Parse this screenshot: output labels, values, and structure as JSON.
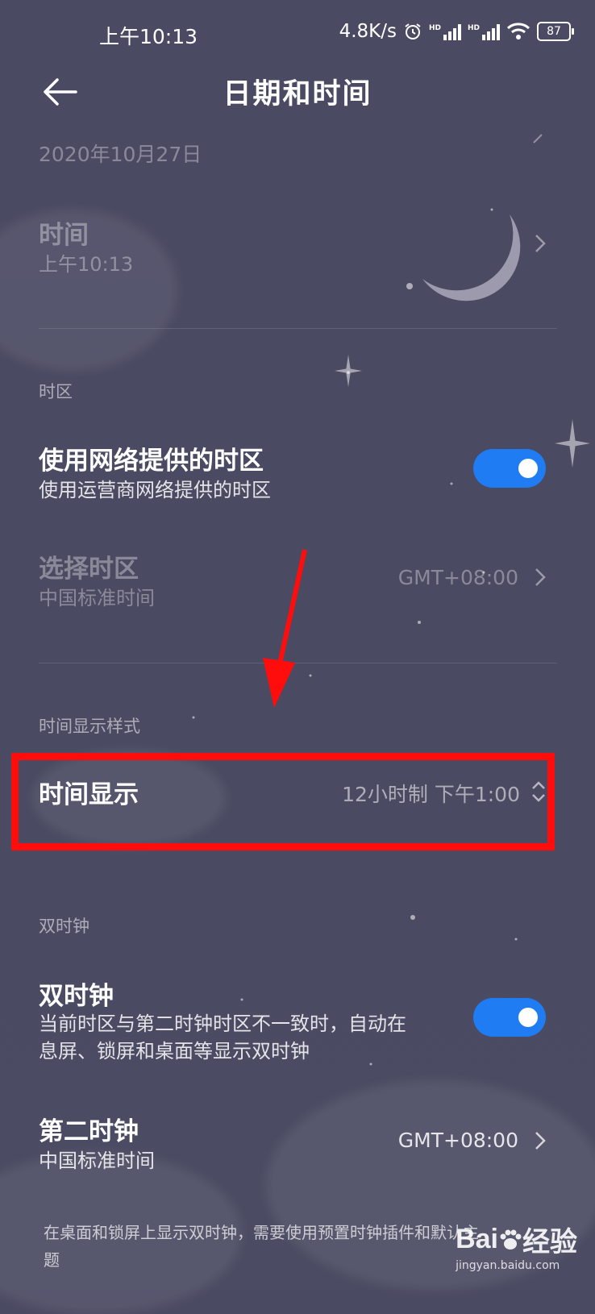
{
  "status_bar": {
    "time": "上午10:13",
    "net_speed": "4.8K/s",
    "battery": "87",
    "icons": [
      "alarm-icon",
      "hd-signal-icon",
      "hd-signal-icon",
      "wifi-icon",
      "battery-icon"
    ]
  },
  "header": {
    "title": "日期和时间",
    "back_icon": "back-arrow-icon"
  },
  "rows": {
    "date_value": "2020年10月27日",
    "time_label": "时间",
    "time_value": "上午10:13"
  },
  "timezone": {
    "section": "时区",
    "network_tz_label": "使用网络提供的时区",
    "network_tz_sub": "使用运营商网络提供的时区",
    "network_tz_on": true,
    "select_tz_label": "选择时区",
    "select_tz_sub": "中国标准时间",
    "select_tz_value": "GMT+08:00"
  },
  "display_style": {
    "section": "时间显示样式",
    "label": "时间显示",
    "value": "12小时制 下午1:00"
  },
  "dual_clock": {
    "section": "双时钟",
    "label": "双时钟",
    "sub_line1": "当前时区与第二时钟时区不一致时，自动在",
    "sub_line2": "息屏、锁屏和桌面等显示双时钟",
    "on": true,
    "second_label": "第二时钟",
    "second_sub": "中国标准时间",
    "second_value": "GMT+08:00"
  },
  "footer": {
    "line1": "在桌面和锁屏上显示双时钟，需要使用预置时钟插件和默认主",
    "line2": "题"
  },
  "watermark": {
    "brand": "Bai",
    "brand2": "经验",
    "site": "jingyan.baidu.com"
  },
  "colors": {
    "background": "#4b4a63",
    "toggle_on": "#1f7cf2",
    "highlight": "#ff0d0d"
  }
}
